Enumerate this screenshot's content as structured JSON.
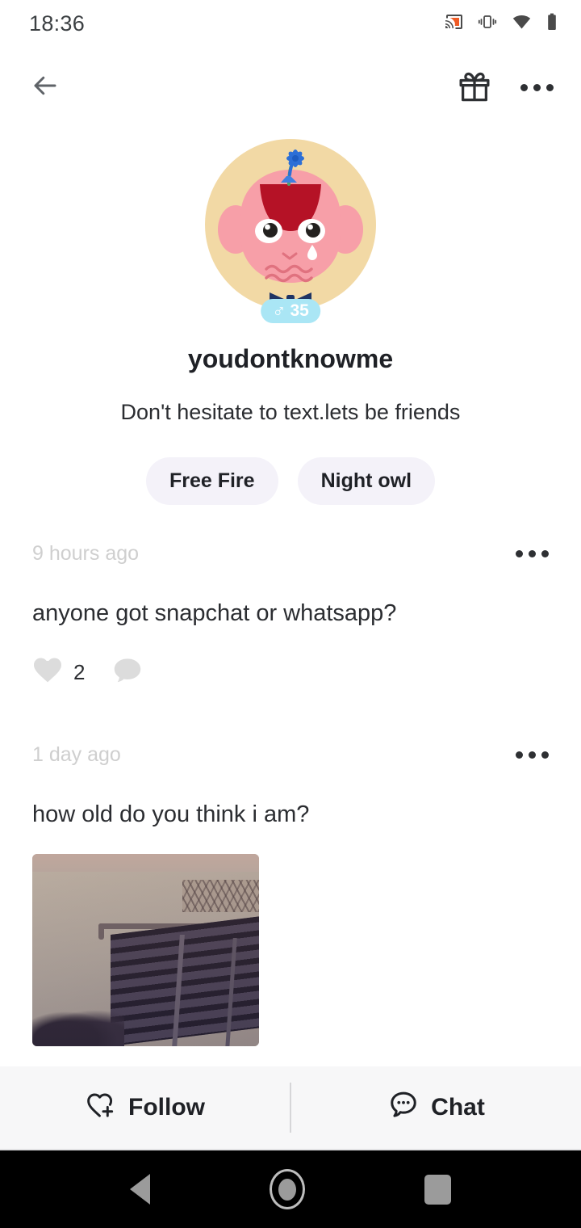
{
  "status_bar": {
    "time": "18:36",
    "icons": [
      "cast-icon",
      "vibrate-icon",
      "wifi-icon",
      "battery-icon"
    ],
    "cast_accent": "#ef5b25"
  },
  "top_nav": {
    "back_icon": "back-arrow-icon",
    "gift_icon": "gift-icon",
    "more_icon": "more-options-icon"
  },
  "profile": {
    "avatar": {
      "icon_name": "user-avatar-cartoon",
      "background_color": "#f2d9a5",
      "face_color": "#f79fa8",
      "hair_color": "#b51226",
      "flower_color": "#2d6fd6",
      "bowtie_color": "#1f3464"
    },
    "gender_badge": {
      "symbol": "♂",
      "age": "35",
      "background_color": "#aae6f5"
    },
    "username": "youdontknowme",
    "bio": "Don't hesitate to text.lets be friends",
    "tags": [
      {
        "label": "Free Fire"
      },
      {
        "label": "Night owl"
      }
    ],
    "tag_background": "#f4f2f9"
  },
  "posts": [
    {
      "time": "9 hours ago",
      "text": "anyone got snapchat or whatsapp?",
      "more_icon": "post-more-icon",
      "like_icon": "heart-filled-icon",
      "like_count": "2",
      "comment_icon": "comment-bubble-icon",
      "comment_count": "",
      "has_photo": false
    },
    {
      "time": "1 day ago",
      "text": "how old do you think i am?",
      "more_icon": "post-more-icon",
      "has_photo": true,
      "photo_alt": "building-exterior-photo"
    }
  ],
  "bottom_bar": {
    "follow_label": "Follow",
    "follow_icon": "heart-plus-icon",
    "chat_label": "Chat",
    "chat_icon": "chat-bubble-dots-icon",
    "background_color": "#f7f7f8"
  },
  "nav_bar": {
    "back_icon": "android-back-icon",
    "home_icon": "android-home-icon",
    "recents_icon": "android-recents-icon",
    "background_color": "#000000"
  }
}
